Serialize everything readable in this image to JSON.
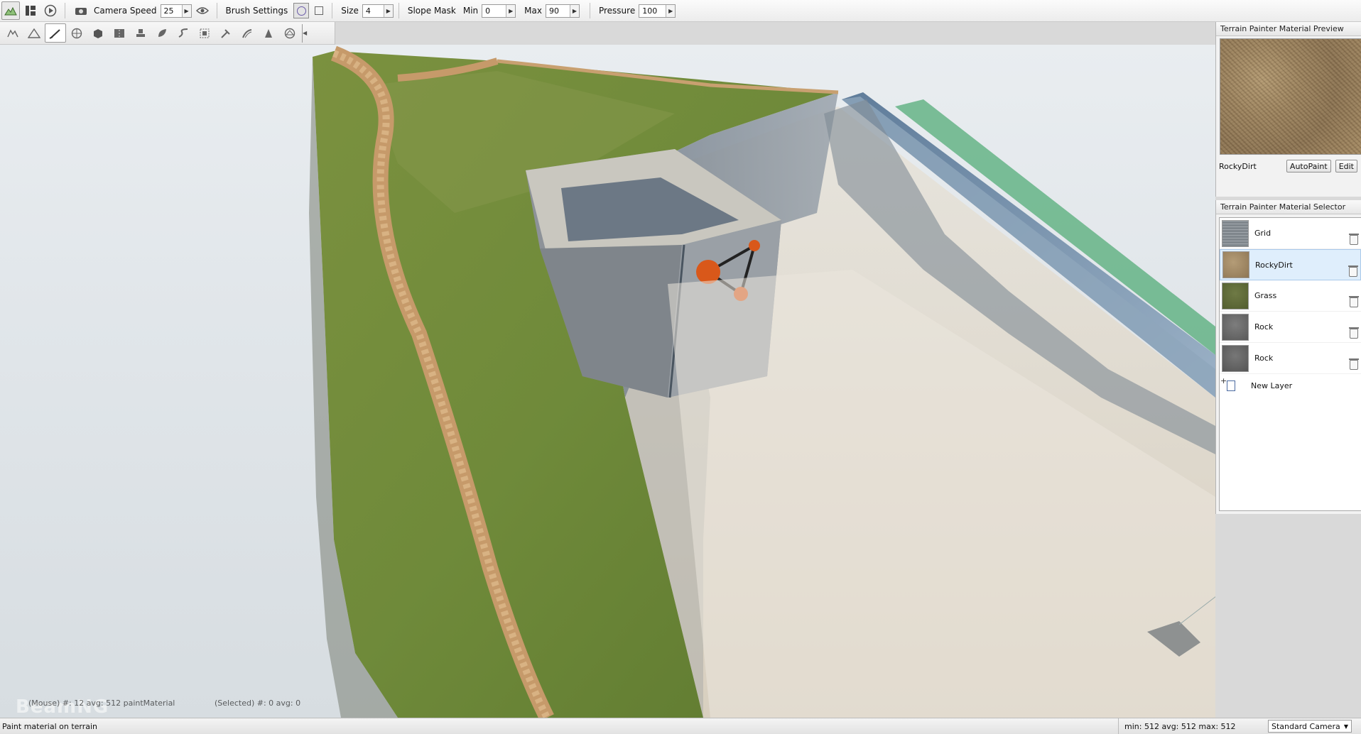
{
  "toolbar": {
    "camera_speed_label": "Camera Speed",
    "camera_speed_value": "25",
    "brush_settings_label": "Brush Settings",
    "size_label": "Size",
    "size_value": "4",
    "slope_mask_label": "Slope Mask",
    "min_label": "Min",
    "min_value": "0",
    "max_label": "Max",
    "max_value": "90",
    "pressure_label": "Pressure",
    "pressure_value": "100"
  },
  "tools": [
    {
      "icon": "terrain-select-icon"
    },
    {
      "icon": "mountain-icon"
    },
    {
      "icon": "paint-brush-icon",
      "active": true
    },
    {
      "icon": "globe-icon"
    },
    {
      "icon": "box-icon"
    },
    {
      "icon": "road-icon"
    },
    {
      "icon": "stamp-icon"
    },
    {
      "icon": "leaf-icon"
    },
    {
      "icon": "river-icon"
    },
    {
      "icon": "selection-icon"
    },
    {
      "icon": "decal-icon"
    },
    {
      "icon": "mesh-road-icon"
    },
    {
      "icon": "forest-icon"
    },
    {
      "icon": "navmesh-icon"
    }
  ],
  "viewport": {
    "hud_mouse": "(Mouse) #: 12  avg: 512  paintMaterial",
    "hud_selected": "(Selected) #: 0   avg: 0",
    "watermark": "BeamNG"
  },
  "preview_panel": {
    "title": "Terrain Painter Material Preview",
    "material_name": "RockyDirt",
    "autopaint_label": "AutoPaint",
    "edit_label": "Edit"
  },
  "selector_panel": {
    "title": "Terrain Painter Material Selector",
    "layers": [
      {
        "name": "Grid",
        "color": "#8e9498"
      },
      {
        "name": "RockyDirt",
        "color": "#a28b66",
        "selected": true
      },
      {
        "name": "Grass",
        "color": "#5f6a3a"
      },
      {
        "name": "Rock",
        "color": "#6b6b6b"
      },
      {
        "name": "Rock",
        "color": "#666666"
      }
    ],
    "new_layer_label": "New Layer"
  },
  "statusbar": {
    "message": "Paint material on terrain",
    "stats": "min: 512  avg: 512  max: 512",
    "camera_mode": "Standard Camera"
  }
}
